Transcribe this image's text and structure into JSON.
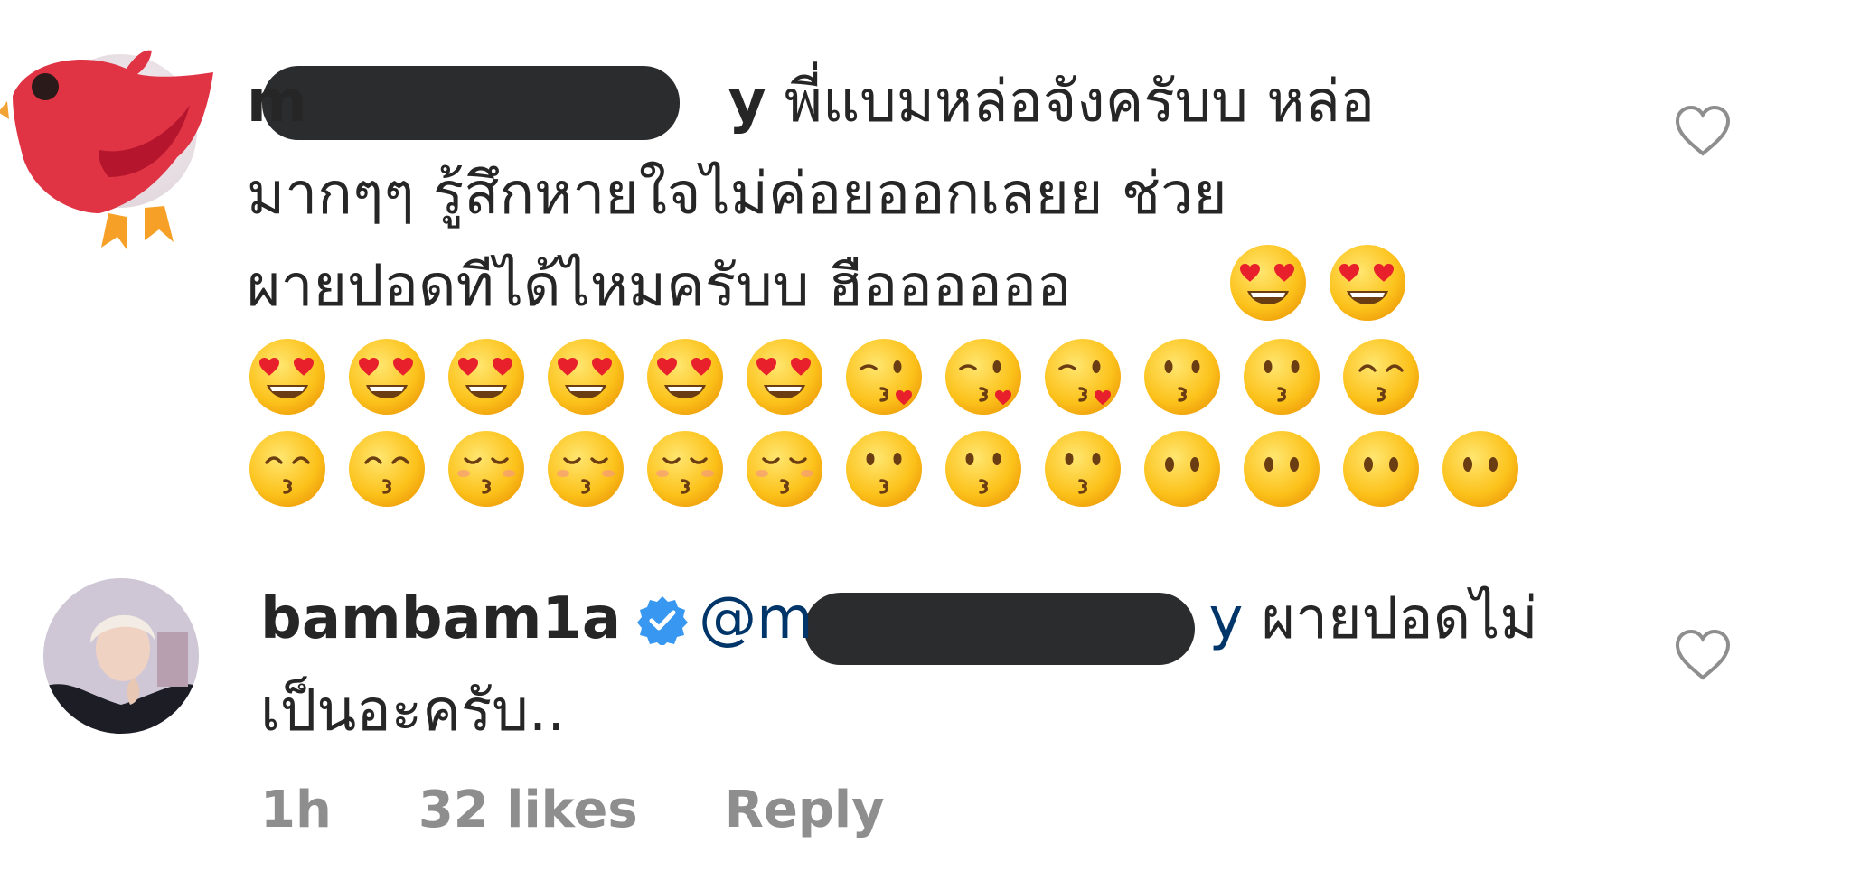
{
  "comments": [
    {
      "username_prefix": "m",
      "username_suffix": "y",
      "text_line1": "พี่แบมหล่อจังครับบ หล่อ",
      "text_line2": "มากๆๆ รู้สึกหายใจไม่ค่อยออกเลยย ช่วย",
      "text_line3": "ผายปอดทีได้ไหมครับบ ฮืออออออ",
      "emoji_inline": [
        "heart-eyes",
        "heart-eyes"
      ],
      "emoji_row1": [
        "heart-eyes",
        "heart-eyes",
        "heart-eyes",
        "heart-eyes",
        "heart-eyes",
        "heart-eyes",
        "kiss-heart",
        "kiss-heart",
        "kiss-heart",
        "kissing",
        "kissing",
        "kissing-smiling"
      ],
      "emoji_row2": [
        "kissing-smiling",
        "kissing-smiling",
        "kissing-closed",
        "kissing-closed",
        "kissing-closed",
        "kissing-closed",
        "kissing",
        "kissing",
        "kissing",
        "no-mouth",
        "no-mouth",
        "no-mouth",
        "no-mouth"
      ]
    },
    {
      "username": "bambam1a",
      "mention_prefix": "@m",
      "mention_suffix": "y",
      "text_line1": "ผายปอดไม่",
      "text_line2": "เป็นอะครับ..",
      "time": "1h",
      "likes": "32 likes",
      "reply": "Reply"
    }
  ],
  "colors": {
    "mention": "#003569",
    "meta": "#8e8e8e",
    "verified": "#3897f0",
    "redaction": "#2b2c2e"
  }
}
